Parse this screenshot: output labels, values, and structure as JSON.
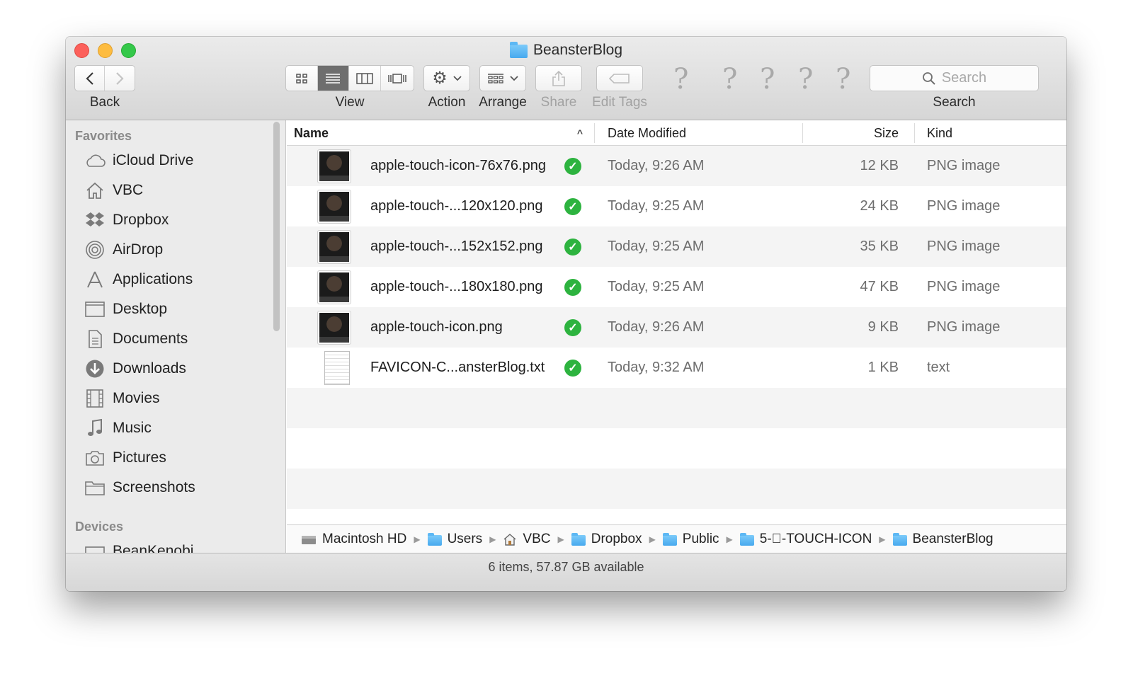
{
  "window": {
    "title": "BeansterBlog"
  },
  "toolbar": {
    "back_label": "Back",
    "view_label": "View",
    "action_label": "Action",
    "arrange_label": "Arrange",
    "share_label": "Share",
    "edit_tags_label": "Edit Tags",
    "search_placeholder": "Search",
    "search_label": "Search",
    "unknown_items": [
      "?",
      "?",
      "?",
      "?",
      "?"
    ]
  },
  "sidebar": {
    "favorites_heading": "Favorites",
    "items": [
      {
        "label": "iCloud Drive",
        "icon": "cloud-icon"
      },
      {
        "label": "VBC",
        "icon": "home-icon"
      },
      {
        "label": "Dropbox",
        "icon": "dropbox-icon"
      },
      {
        "label": "AirDrop",
        "icon": "airdrop-icon"
      },
      {
        "label": "Applications",
        "icon": "applications-icon"
      },
      {
        "label": "Desktop",
        "icon": "desktop-icon"
      },
      {
        "label": "Documents",
        "icon": "documents-icon"
      },
      {
        "label": "Downloads",
        "icon": "downloads-icon"
      },
      {
        "label": "Movies",
        "icon": "movies-icon"
      },
      {
        "label": "Music",
        "icon": "music-icon"
      },
      {
        "label": "Pictures",
        "icon": "pictures-icon"
      },
      {
        "label": "Screenshots",
        "icon": "folder-icon"
      }
    ],
    "devices_heading": "Devices",
    "devices": [
      {
        "label": "BeanKenobi",
        "icon": "drive-icon"
      }
    ]
  },
  "columns": {
    "name": "Name",
    "date": "Date Modified",
    "size": "Size",
    "kind": "Kind",
    "sort_indicator": "^"
  },
  "files": [
    {
      "name": "apple-touch-icon-76x76.png",
      "date": "Today, 9:26 AM",
      "size": "12 KB",
      "kind": "PNG image",
      "type": "image"
    },
    {
      "name": "apple-touch-...120x120.png",
      "date": "Today, 9:25 AM",
      "size": "24 KB",
      "kind": "PNG image",
      "type": "image"
    },
    {
      "name": "apple-touch-...152x152.png",
      "date": "Today, 9:25 AM",
      "size": "35 KB",
      "kind": "PNG image",
      "type": "image"
    },
    {
      "name": "apple-touch-...180x180.png",
      "date": "Today, 9:25 AM",
      "size": "47 KB",
      "kind": "PNG image",
      "type": "image"
    },
    {
      "name": "apple-touch-icon.png",
      "date": "Today, 9:26 AM",
      "size": "9 KB",
      "kind": "PNG image",
      "type": "image"
    },
    {
      "name": "FAVICON-C...ansterBlog.txt",
      "date": "Today, 9:32 AM",
      "size": "1 KB",
      "kind": "text",
      "type": "text"
    }
  ],
  "sync_status": "✓",
  "path": [
    {
      "label": "Macintosh HD",
      "icon": "hard-drive-icon"
    },
    {
      "label": "Users",
      "icon": "users-folder-icon"
    },
    {
      "label": "VBC",
      "icon": "home-icon"
    },
    {
      "label": "Dropbox",
      "icon": "dropbox-folder-icon"
    },
    {
      "label": "Public",
      "icon": "public-folder-icon"
    },
    {
      "label": "5--TOUCH-ICON",
      "icon": "folder-icon"
    },
    {
      "label": "BeansterBlog",
      "icon": "folder-icon"
    }
  ],
  "status": "6 items, 57.87 GB available"
}
